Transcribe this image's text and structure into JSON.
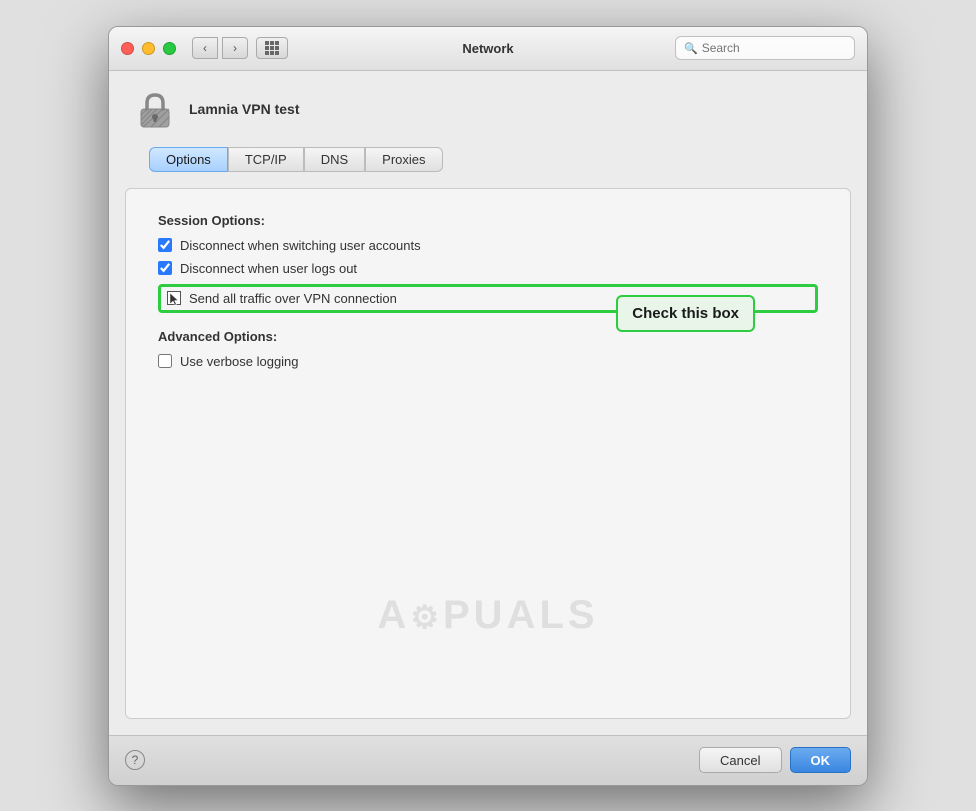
{
  "window": {
    "title": "Network"
  },
  "titlebar": {
    "back_label": "‹",
    "forward_label": "›",
    "search_placeholder": "Search"
  },
  "vpn": {
    "name": "Lamnia VPN test"
  },
  "tabs": [
    {
      "id": "options",
      "label": "Options",
      "active": true
    },
    {
      "id": "tcpip",
      "label": "TCP/IP",
      "active": false
    },
    {
      "id": "dns",
      "label": "DNS",
      "active": false
    },
    {
      "id": "proxies",
      "label": "Proxies",
      "active": false
    }
  ],
  "panel": {
    "session_options_title": "Session Options:",
    "checkboxes": [
      {
        "id": "disconnect-switch",
        "label": "Disconnect when switching user accounts",
        "checked": true
      },
      {
        "id": "disconnect-logout",
        "label": "Disconnect when user logs out",
        "checked": true
      }
    ],
    "highlighted_checkbox": {
      "label": "Send all traffic over VPN connection",
      "checked": false
    },
    "advanced_options_title": "Advanced Options:",
    "advanced_checkboxes": [
      {
        "id": "verbose-logging",
        "label": "Use verbose logging",
        "checked": false
      }
    ]
  },
  "tooltip": {
    "text": "Check this box"
  },
  "watermark": {
    "text": "A⚙PUALS"
  },
  "bottom": {
    "help_label": "?",
    "cancel_label": "Cancel",
    "ok_label": "OK"
  }
}
